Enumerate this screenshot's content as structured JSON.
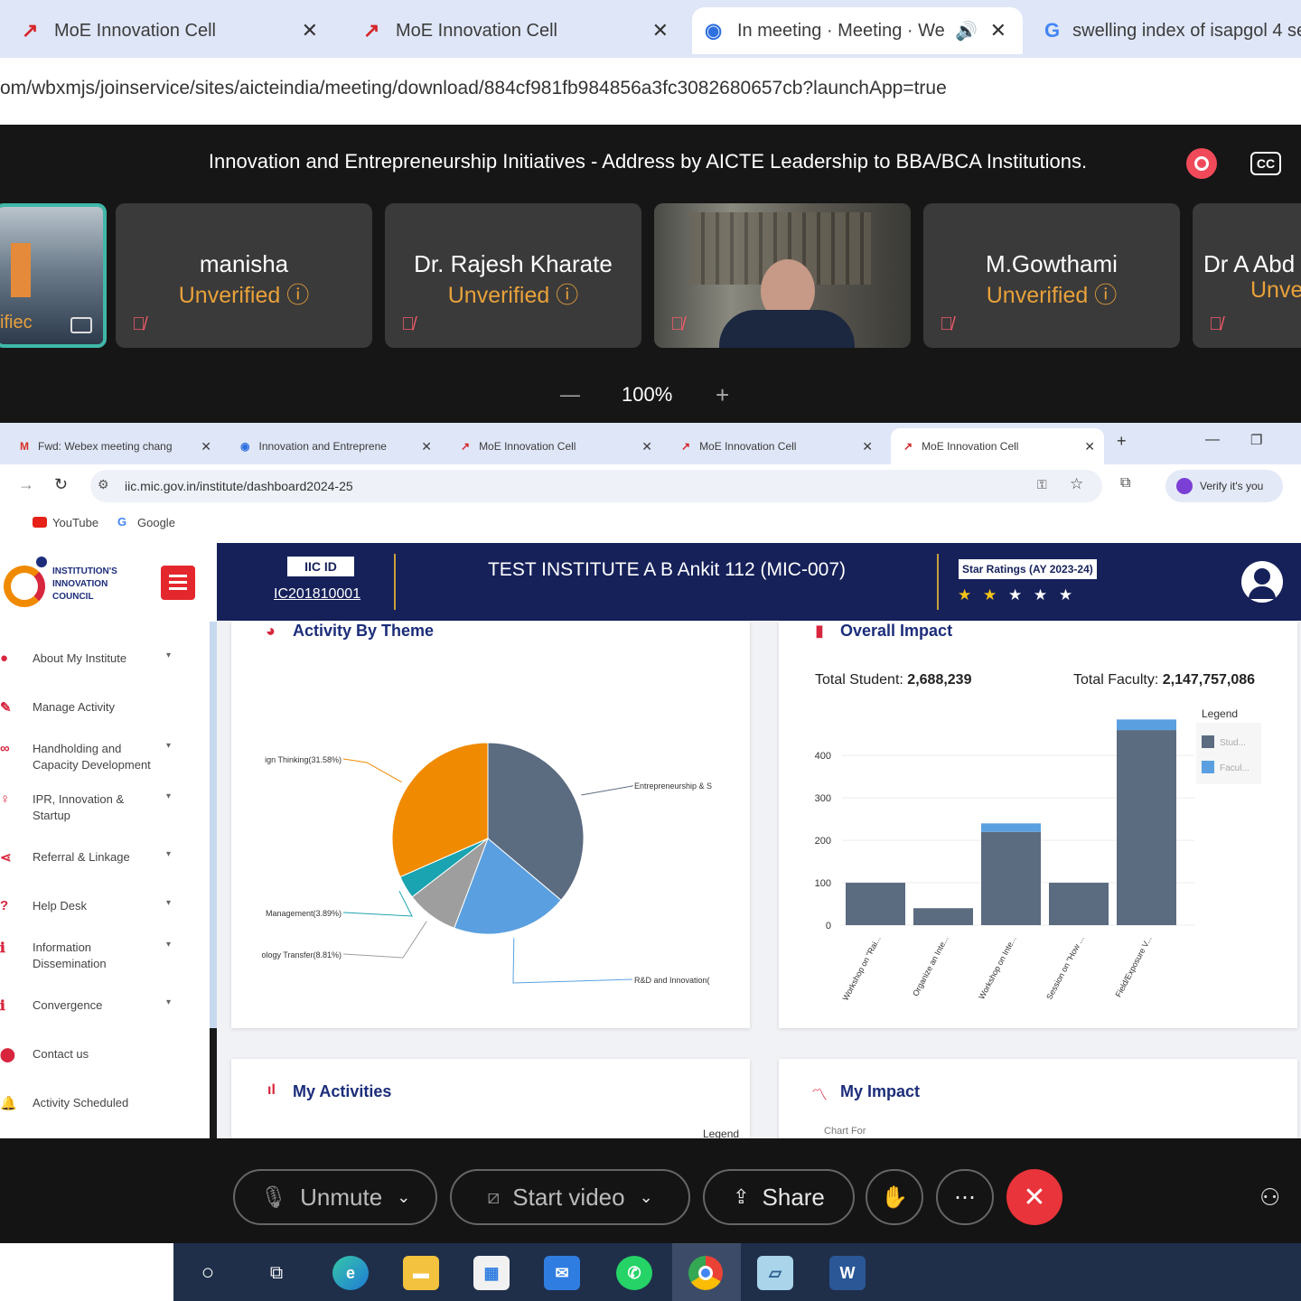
{
  "outer_browser": {
    "tabs": [
      {
        "title": "MoE Innovation Cell"
      },
      {
        "title": "MoE Innovation Cell"
      },
      {
        "title": "In meeting · Meeting · Web"
      },
      {
        "title": "swelling index of isapgol 4 se"
      }
    ],
    "url": "om/wbxmjs/joinservice/sites/aicteindia/meeting/download/884cf981fb984856a3fc3082680657cb?launchApp=true"
  },
  "meeting": {
    "title": "Innovation and Entrepreneurship Initiatives - Address by AICTE Leadership to BBA/BCA Institutions.",
    "cc_label": "CC",
    "participants": [
      {
        "name": "",
        "status": "ifiec"
      },
      {
        "name": "manisha",
        "status": "Unverified"
      },
      {
        "name": "Dr. Rajesh Kharate",
        "status": "Unverified"
      },
      {
        "name": "",
        "status": ""
      },
      {
        "name": "M.Gowthami",
        "status": "Unverified"
      },
      {
        "name": "Dr A Abd",
        "status": "Unve"
      }
    ],
    "zoom": "100%",
    "zoom_minus": "—",
    "zoom_plus": "+"
  },
  "inner_browser": {
    "tabs": [
      {
        "title": "Fwd: Webex meeting chang"
      },
      {
        "title": "Innovation and Entreprene"
      },
      {
        "title": "MoE Innovation Cell"
      },
      {
        "title": "MoE Innovation Cell"
      },
      {
        "title": "MoE Innovation Cell"
      }
    ],
    "url": "iic.mic.gov.in/institute/dashboard2024-25",
    "verify_label": "Verify it's you",
    "bookmarks": [
      "YouTube",
      "Google"
    ]
  },
  "iic": {
    "logo_lines": [
      "INSTITUTION'S",
      "INNOVATION",
      "COUNCIL"
    ],
    "iic_id_label": "IIC ID",
    "iic_id": "IC201810001",
    "institute_name": "TEST INSTITUTE A B Ankit 112 (MIC-007)",
    "star_ratings_label": "Star Ratings (AY 2023-24)",
    "stars": "★ ★ ★ ★ ★",
    "stars_filled": 2,
    "stars_total": 5,
    "sidebar": [
      {
        "label": "About My Institute",
        "icon": "user-icon",
        "chevron": true
      },
      {
        "label": "Manage Activity",
        "icon": "edit-icon",
        "chevron": false
      },
      {
        "label": "Handholding and Capacity Development",
        "icon": "handshake-icon",
        "chevron": true
      },
      {
        "label": "IPR, Innovation & Startup",
        "icon": "bulb-icon",
        "chevron": true
      },
      {
        "label": "Referral & Linkage",
        "icon": "share-icon",
        "chevron": true
      },
      {
        "label": "Help Desk",
        "icon": "question-icon",
        "chevron": true
      },
      {
        "label": "Information Dissemination",
        "icon": "info-icon",
        "chevron": true
      },
      {
        "label": "Convergence",
        "icon": "info-icon",
        "chevron": true
      },
      {
        "label": "Contact us",
        "icon": "location-icon",
        "chevron": false
      },
      {
        "label": "Activity Scheduled",
        "icon": "bell-icon",
        "chevron": false
      }
    ],
    "cards": {
      "activity_by_theme": "Activity By Theme",
      "overall_impact": "Overall Impact",
      "total_student_label": "Total Student:",
      "total_student": "2,688,239",
      "total_faculty_label": "Total Faculty:",
      "total_faculty": "2,147,757,086",
      "my_activities": "My Activities",
      "my_activities_legend": "Legend",
      "my_impact": "My Impact",
      "my_impact_sub": "Chart For"
    }
  },
  "chart_data": [
    {
      "type": "pie",
      "title": "Activity By Theme",
      "labels": [
        "Entrepreneurship & S",
        "R&D and Innovation(",
        "ology Transfer(8.81%)",
        "Management(3.89%)",
        "ign Thinking(31.58%)"
      ],
      "values": [
        36.15,
        19.57,
        8.81,
        3.89,
        31.58
      ],
      "colors": [
        "#5b6b80",
        "#5aa0e0",
        "#9e9e9e",
        "#1aa3b0",
        "#f08a00"
      ]
    },
    {
      "type": "bar",
      "title": "Overall Impact",
      "categories": [
        "Workshop on \"Rai...",
        "Organize an Inte...",
        "Workshop on Inte...",
        "Session on \"How ...",
        "Field/Exposure V..."
      ],
      "series": [
        {
          "name": "Stud...",
          "values": [
            100,
            40,
            220,
            100,
            460
          ]
        },
        {
          "name": "Facul...",
          "values": [
            0,
            0,
            20,
            0,
            25
          ]
        }
      ],
      "legend_title": "Legend",
      "ylim": [
        0,
        490
      ],
      "yticks": [
        0,
        100,
        200,
        300,
        400
      ],
      "colors": [
        "#5b6b80",
        "#5aa0e0"
      ]
    }
  ],
  "controls": {
    "unmute": "Unmute",
    "start_video": "Start video",
    "share": "Share"
  }
}
